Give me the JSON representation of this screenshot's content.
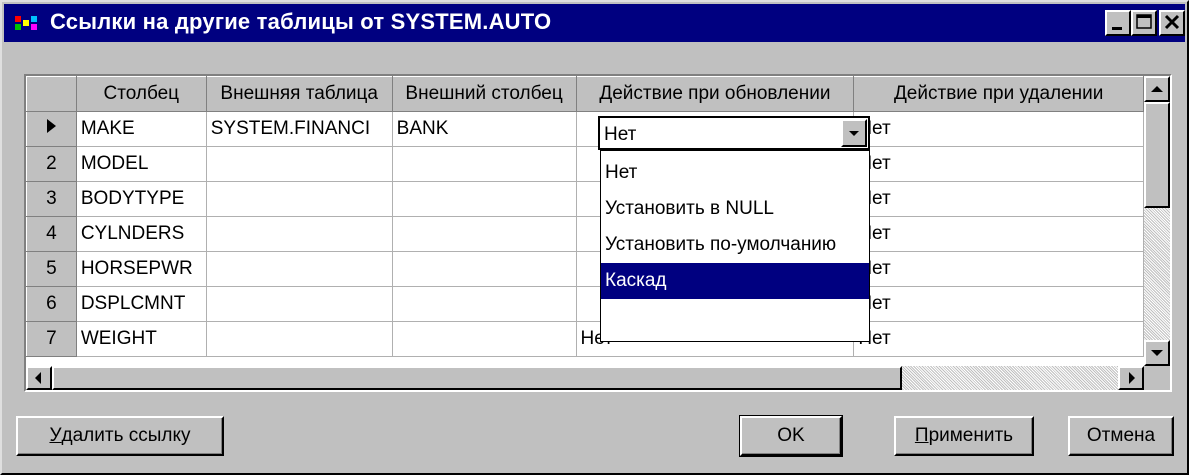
{
  "window": {
    "title": "Ссылки на другие таблицы от SYSTEM.AUTO"
  },
  "grid": {
    "columns": [
      "Столбец",
      "Внешняя таблица",
      "Внешний столбец",
      "Действие при обновлении",
      "Действие при удалении"
    ],
    "rows": [
      {
        "marker": "current",
        "num": "",
        "column": "MAKE",
        "foreign_table": "SYSTEM.FINANCI",
        "foreign_column": "BANK",
        "on_update": "Нет",
        "on_delete": "Нет"
      },
      {
        "marker": "",
        "num": "2",
        "column": "MODEL",
        "foreign_table": "",
        "foreign_column": "",
        "on_update": "",
        "on_delete": "Нет"
      },
      {
        "marker": "",
        "num": "3",
        "column": "BODYTYPE",
        "foreign_table": "",
        "foreign_column": "",
        "on_update": "",
        "on_delete": "Нет"
      },
      {
        "marker": "",
        "num": "4",
        "column": "CYLNDERS",
        "foreign_table": "",
        "foreign_column": "",
        "on_update": "",
        "on_delete": "Нет"
      },
      {
        "marker": "",
        "num": "5",
        "column": "HORSEPWR",
        "foreign_table": "",
        "foreign_column": "",
        "on_update": "",
        "on_delete": "Нет"
      },
      {
        "marker": "",
        "num": "6",
        "column": "DSPLCMNT",
        "foreign_table": "",
        "foreign_column": "",
        "on_update": "",
        "on_delete": "Нет"
      },
      {
        "marker": "",
        "num": "7",
        "column": "WEIGHT",
        "foreign_table": "",
        "foreign_column": "",
        "on_update": "Нет",
        "on_delete": "Нет"
      }
    ],
    "editor": {
      "value": "Нет",
      "options": [
        "Нет",
        "Установить в NULL",
        "Установить по-умолчанию",
        "Каскад",
        ""
      ],
      "selected_index": 3
    }
  },
  "buttons": {
    "delete_link": {
      "accel": "У",
      "rest": "далить ссылку"
    },
    "ok": "OK",
    "apply": {
      "accel": "П",
      "rest": "рименить"
    },
    "cancel": "Отмена"
  },
  "colors": {
    "titlebar": "#000080",
    "face": "#c0c0c0",
    "selection": "#000080"
  }
}
